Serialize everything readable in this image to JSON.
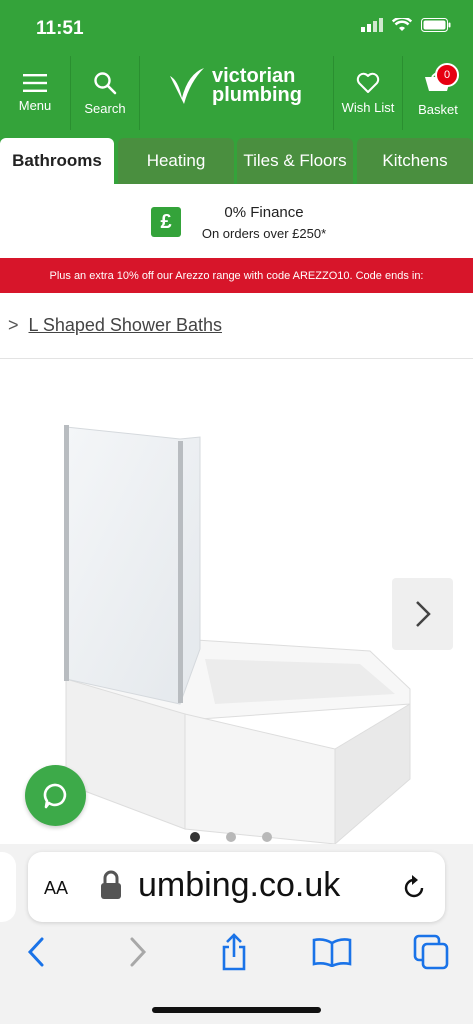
{
  "status_bar": {
    "time": "11:51"
  },
  "header": {
    "menu_label": "Menu",
    "search_label": "Search",
    "logo_line1": "victorian",
    "logo_line2": "plumbing",
    "wishlist_label": "Wish List",
    "basket_label": "Basket",
    "basket_count": "0"
  },
  "tabs": [
    {
      "label": "Bathrooms",
      "active": true
    },
    {
      "label": "Heating",
      "active": false
    },
    {
      "label": "Tiles & Floors",
      "active": false
    },
    {
      "label": "Kitchens",
      "active": false
    }
  ],
  "finance": {
    "icon_glyph": "£",
    "title": "0% Finance",
    "subtitle": "On orders over £250*"
  },
  "promo": {
    "text": "Plus an extra 10% off our Arezzo range with code AREZZO10. Code ends in:"
  },
  "breadcrumb": {
    "chevron": ">",
    "link": "L Shaped Shower Baths"
  },
  "carousel": {
    "active_index": 0,
    "count": 3
  },
  "browser": {
    "text_size_label": "AA",
    "url": "umbing.co.uk"
  },
  "colors": {
    "brand_green": "#34a33a",
    "promo_red": "#d7152a",
    "ios_blue": "#1a73e8"
  }
}
